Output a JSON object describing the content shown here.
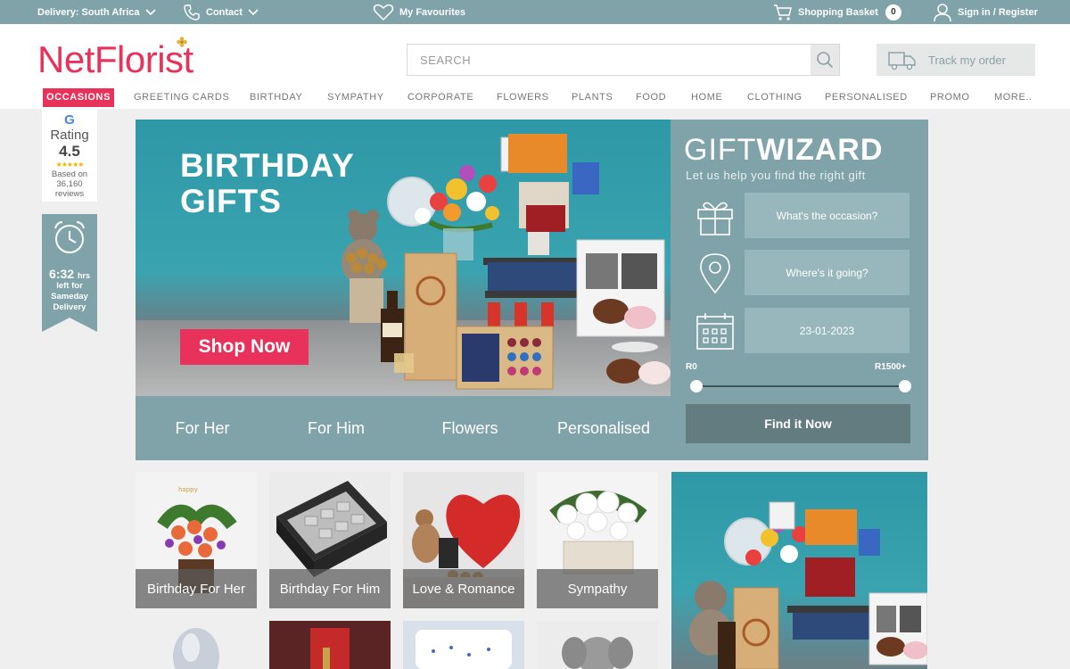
{
  "topbar": {
    "delivery": "Delivery: South Africa",
    "contact": "Contact",
    "favourites": "My Favourites",
    "basket": "Shopping Basket",
    "basket_count": "0",
    "signin": "Sign in / Register"
  },
  "header": {
    "logo": "NetFlorist",
    "search_placeholder": "SEARCH",
    "track_label": "Track my order"
  },
  "nav": [
    "OCCASIONS",
    "GREETING CARDS",
    "BIRTHDAY",
    "SYMPATHY",
    "CORPORATE",
    "FLOWERS",
    "PLANTS",
    "FOOD",
    "HOME",
    "CLOTHING",
    "PERSONALISED",
    "PROMO",
    "MORE.."
  ],
  "rating": {
    "google": "G",
    "label": "Rating",
    "score": "4.5",
    "based_on": "Based on",
    "count": "36,160",
    "reviews": "reviews",
    "stars": "★★★★★"
  },
  "sameday": {
    "time": "6:32",
    "unit": "hrs",
    "line1": "left for",
    "line2": "Sameday",
    "line3": "Delivery"
  },
  "hero": {
    "title_line1": "BIRTHDAY",
    "title_line2": "GIFTS",
    "cta": "Shop Now",
    "links": [
      "For Her",
      "For Him",
      "Flowers",
      "Personalised"
    ]
  },
  "wizard": {
    "title_light": "GIFT",
    "title_bold": "WIZARD",
    "subtitle": "Let us help you find the right gift",
    "occasion_placeholder": "What's the occasion?",
    "location_placeholder": "Where's it going?",
    "date": "23-01-2023",
    "range_min": "R0",
    "range_max": "R1500+",
    "button": "Find it Now"
  },
  "tiles": [
    "Birthday For Her",
    "Birthday For Him",
    "Love & Romance",
    "Sympathy"
  ],
  "colors": {
    "brand": "#e8315b",
    "teal": "#7fa3a9"
  }
}
